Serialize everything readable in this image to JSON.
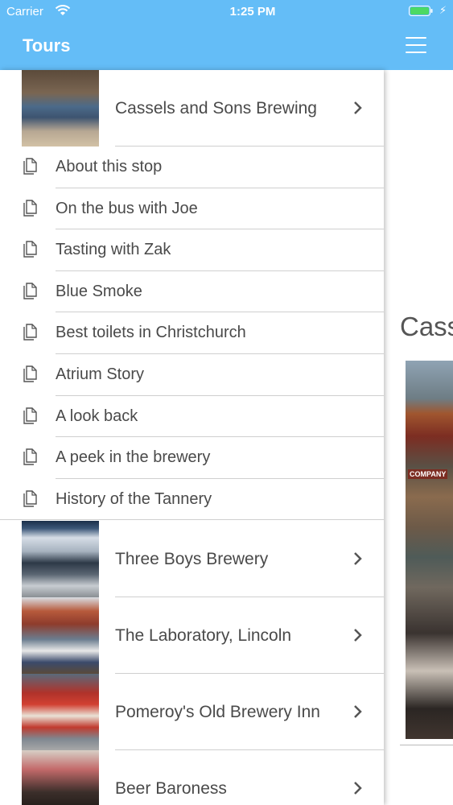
{
  "status_bar": {
    "carrier": "Carrier",
    "time": "1:25 PM"
  },
  "drawer": {
    "title": "Tours",
    "tours": [
      {
        "label": "Cassels and Sons Brewing"
      },
      {
        "label": "Three Boys Brewery"
      },
      {
        "label": "The Laboratory, Lincoln"
      },
      {
        "label": "Pomeroy's Old Brewery Inn"
      },
      {
        "label": "Beer Baroness"
      }
    ],
    "stops": [
      {
        "label": "About this stop"
      },
      {
        "label": "On the bus with Joe"
      },
      {
        "label": "Tasting with Zak"
      },
      {
        "label": "Blue Smoke"
      },
      {
        "label": "Best toilets in Christchurch"
      },
      {
        "label": "Atrium Story"
      },
      {
        "label": "A look back"
      },
      {
        "label": "A peek in the brewery"
      },
      {
        "label": "History of the Tannery"
      }
    ]
  },
  "main": {
    "title": "Cass",
    "photo_label": "COMPANY"
  },
  "colors": {
    "header": "#64bdf7",
    "text": "#4a4a4a",
    "separator": "#cfcfcf"
  },
  "icons": {
    "menu": "hamburger-menu-icon",
    "chevron": "chevron-right-icon",
    "doc": "document-icon"
  }
}
